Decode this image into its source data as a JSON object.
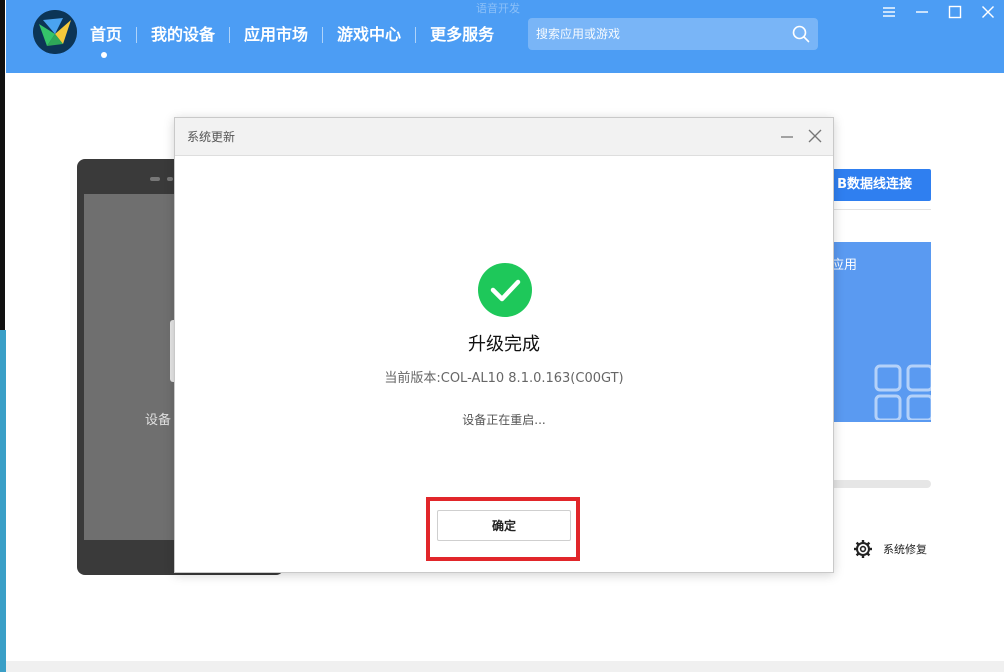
{
  "header": {
    "ghost_text": "语音开发",
    "nav": [
      {
        "label": "首页",
        "active": true
      },
      {
        "label": "我的设备"
      },
      {
        "label": "应用市场"
      },
      {
        "label": "游戏中心"
      },
      {
        "label": "更多服务"
      }
    ],
    "search": {
      "placeholder": "搜索应用或游戏",
      "icon": "search-icon"
    },
    "window_controls": [
      "menu-icon",
      "minimize-icon",
      "maximize-icon",
      "close-icon"
    ]
  },
  "background": {
    "device_label": "设备",
    "usb_button": "B数据线连接",
    "app_card_label": "应用",
    "system_repair": "系统修复"
  },
  "dialog": {
    "title": "系统更新",
    "status_title": "升级完成",
    "version_label": "当前版本:",
    "version_value": "COL-AL10 8.1.0.163(C00GT)",
    "status_text": "设备正在重启...",
    "ok_button": "确定"
  },
  "colors": {
    "header_bg": "#4c9df4",
    "success_green": "#1ec85a",
    "highlight_red": "#e1262a",
    "primary_blue": "#2f7ff0"
  }
}
